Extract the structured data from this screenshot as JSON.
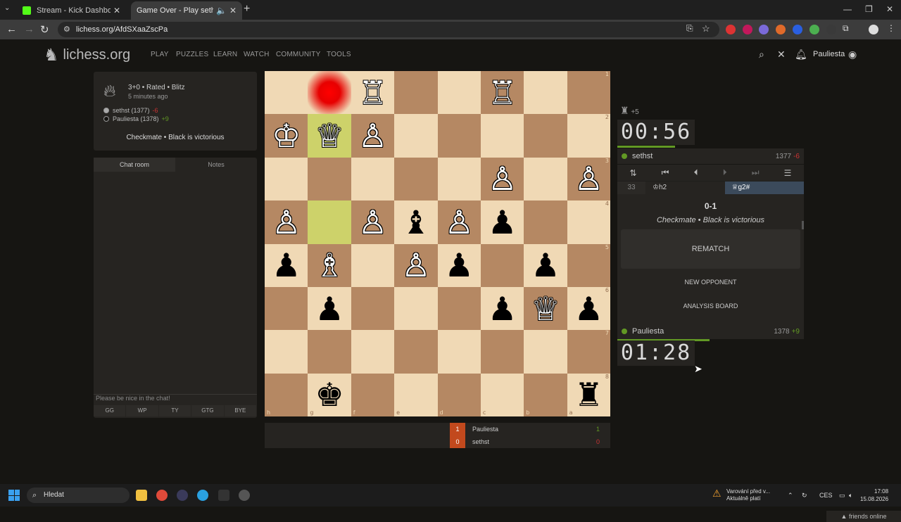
{
  "browser": {
    "tabs": [
      {
        "title": "Stream - Kick Dashboard",
        "active": false,
        "icon_color": "#53fc18"
      },
      {
        "title": "Game Over - Play sethst • lichess.org",
        "active": true,
        "icon_color": "#ffffff"
      }
    ],
    "url": "lichess.org/AfdSXaaZscPa"
  },
  "site": {
    "logo": "lichess.org",
    "nav": [
      "PLAY",
      "PUZZLES",
      "LEARN",
      "WATCH",
      "COMMUNITY",
      "TOOLS"
    ],
    "username": "Pauliesta"
  },
  "game_info": {
    "type": "3+0 • Rated • Blitz",
    "time_ago": "5 minutes ago",
    "players": [
      {
        "name": "sethst (1377)",
        "diff": "-6",
        "color": "white"
      },
      {
        "name": "Pauliesta (1378)",
        "diff": "+9",
        "color": "black"
      }
    ],
    "result": "Checkmate • Black is victorious"
  },
  "chat": {
    "tabs": [
      "Chat room",
      "Notes"
    ],
    "placeholder": "Please be nice in the chat!",
    "quick": [
      "GG",
      "WP",
      "TY",
      "GTG",
      "BYE"
    ]
  },
  "board": {
    "orientation": "black",
    "ranks": [
      "1",
      "2",
      "3",
      "4",
      "5",
      "6",
      "7",
      "8"
    ],
    "files": [
      "h",
      "g",
      "f",
      "e",
      "d",
      "c",
      "b",
      "a"
    ],
    "pieces": [
      [
        "",
        "",
        "♖",
        "",
        "",
        "♖",
        "",
        ""
      ],
      [
        "♔",
        "♕",
        "♙",
        "",
        "",
        "",
        "",
        ""
      ],
      [
        "",
        "",
        "",
        "",
        "",
        "♙",
        "",
        "♙"
      ],
      [
        "♙",
        "",
        "♙",
        "♝",
        "♙",
        "♟",
        "",
        ""
      ],
      [
        "♟",
        "♗",
        "",
        "♙",
        "♟",
        "",
        "♟",
        ""
      ],
      [
        "",
        "♟",
        "",
        "",
        "",
        "♟",
        "♕",
        "♟"
      ],
      [
        "",
        "",
        "",
        "",
        "",
        "",
        "",
        ""
      ],
      [
        "",
        "♚",
        "",
        "",
        "",
        "",
        "",
        "♜"
      ]
    ]
  },
  "crosstable": [
    {
      "score": "1",
      "name": "Pauliesta",
      "pts": "1"
    },
    {
      "score": "0",
      "name": "sethst",
      "pts": "0"
    }
  ],
  "right": {
    "captured": "+5",
    "top_clock": "00:56",
    "bottom_clock": "01:28",
    "top_player": {
      "name": "sethst",
      "rating": "1377",
      "diff": "-6"
    },
    "bottom_player": {
      "name": "Pauliesta",
      "rating": "1378",
      "diff": "+9"
    },
    "move_index": "33",
    "move_white": "♔h2",
    "move_black": "♕g2#",
    "score": "0-1",
    "result": "Checkmate • Black is victorious",
    "rematch": "REMATCH",
    "new_opponent": "NEW OPPONENT",
    "analysis": "ANALYSIS BOARD",
    "friends": "friends online"
  },
  "taskbar": {
    "search": "Hledat",
    "warning_line1": "Varování před v...",
    "warning_line2": "Aktuálně platí",
    "lang": "CES",
    "time": "17:08",
    "date": "15.08.2026"
  }
}
